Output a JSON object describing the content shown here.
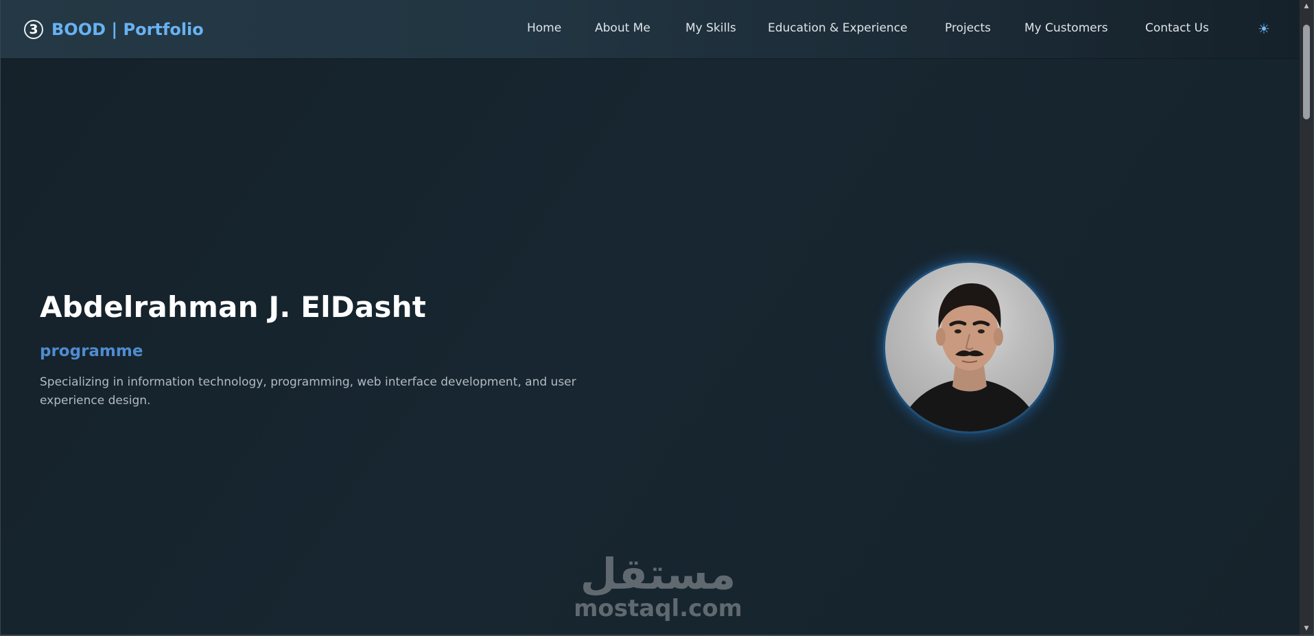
{
  "brand": {
    "badge": "3",
    "title": "BOOD | Portfolio"
  },
  "nav": {
    "items": [
      {
        "label": "Home"
      },
      {
        "label": "About Me"
      },
      {
        "label": "My Skills"
      },
      {
        "label": "Education & Experience"
      },
      {
        "label": "Projects"
      },
      {
        "label": "My Customers"
      },
      {
        "label": "Contact Us"
      }
    ],
    "theme_toggle_icon": "sun-icon"
  },
  "hero": {
    "name": "Abdelrahman J. ElDasht",
    "role": "programme",
    "description": "Specializing in information technology, programming, web interface development, and user experience design.",
    "avatar_icon": "profile-photo"
  },
  "watermark": {
    "arabic": "مستقل",
    "domain": "mostaql.com"
  },
  "colors": {
    "background": "#16222c",
    "navbar": "#223542",
    "accent": "#68b2f2",
    "role": "#4f8ccf",
    "text": "#ffffff",
    "muted": "#b3bbc2"
  }
}
